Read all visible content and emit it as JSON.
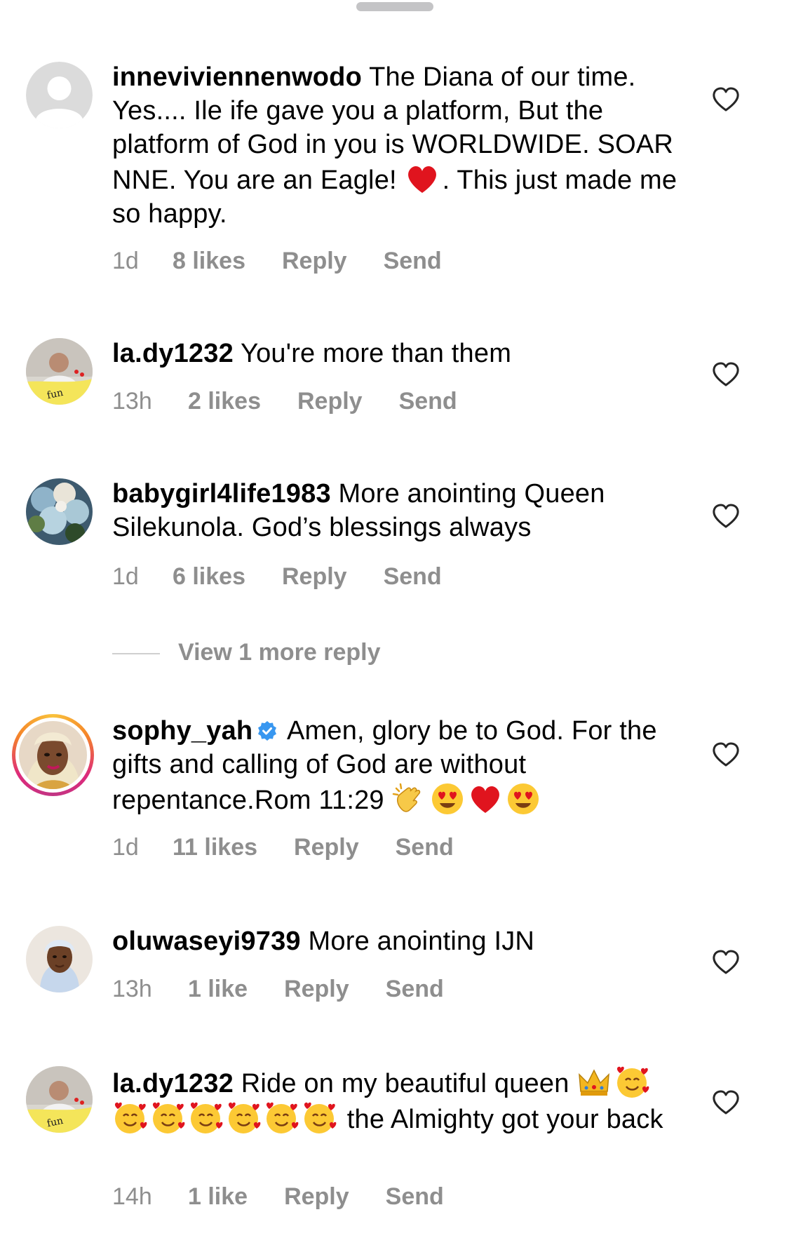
{
  "comments": [
    {
      "username": "inneviviennenwodo",
      "text_1": " The Diana of our time. Yes.... Ile ife gave you a platform, But the platform of God in you is WORLDWIDE. SOAR NNE. You are an Eagle! ",
      "text_2": ". This just made me so happy.",
      "time": "1d",
      "likes": "8 likes",
      "reply": "Reply",
      "send": "Send"
    },
    {
      "username": "la.dy1232",
      "text_1": " You're more than them",
      "time": "13h",
      "likes": "2 likes",
      "reply": "Reply",
      "send": "Send"
    },
    {
      "username": "babygirl4life1983",
      "text_1": " More anointing Queen Silekunola. God’s blessings always",
      "time": "1d",
      "likes": "6 likes",
      "reply": "Reply",
      "send": "Send"
    },
    {
      "username": "sophy_yah",
      "text_1": " Amen, glory be to God. For the gifts and calling of God are without repentance.Rom 11:29 ",
      "time": "1d",
      "likes": "11 likes",
      "reply": "Reply",
      "send": "Send"
    },
    {
      "username": "oluwaseyi9739",
      "text_1": " More anointing IJN",
      "time": "13h",
      "likes": "1 like",
      "reply": "Reply",
      "send": "Send"
    },
    {
      "username": "la.dy1232",
      "text_1": " Ride on my beautiful queen ",
      "text_2": " the Almighty got your back",
      "time": "14h",
      "likes": "1 like",
      "reply": "Reply",
      "send": "Send"
    }
  ],
  "view_more_replies": "View 1 more reply",
  "icons": {
    "like": "heart-outline-icon",
    "verified": "verified-badge-icon",
    "placeholder_avatar": "default-avatar-icon"
  },
  "colors": {
    "secondary_text": "#8e8e8e",
    "verified_blue": "#3897f0",
    "heart_red": "#e0141e"
  }
}
